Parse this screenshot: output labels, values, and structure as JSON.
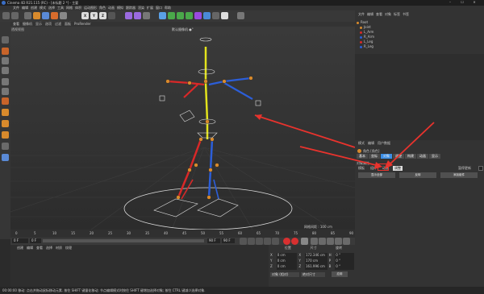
{
  "window": {
    "title": "Cinema 4D R21.115 (RC) - [未标题 2 *] - 主要"
  },
  "menubar": {
    "items": [
      "文件",
      "编辑",
      "创建",
      "模式",
      "选择",
      "工具",
      "网格",
      "体积",
      "运动图形",
      "角色",
      "动画",
      "模拟",
      "跟踪器",
      "渲染",
      "扩展",
      "窗口",
      "帮助"
    ]
  },
  "viewport": {
    "menu": [
      "查看",
      "摄像机",
      "显示",
      "选项",
      "过滤",
      "面板",
      "ProRender"
    ],
    "camera_label": "默认摄像机 ●°",
    "top_left_label": "透视视图",
    "grid_label": "网格间距 : 100 cm"
  },
  "object_manager": {
    "menu": [
      "文件",
      "编辑",
      "查看",
      "对象",
      "标签",
      "书签"
    ],
    "objects": [
      "Root",
      "Joint",
      "L_Arm",
      "R_Arm",
      "L_Leg",
      "R_Leg"
    ]
  },
  "attribute_manager": {
    "menu": [
      "模式",
      "编辑",
      "用户数据"
    ],
    "object_title": "角色 [角色]",
    "tabs": [
      "基本",
      "坐标",
      "对象",
      "调整",
      "构建",
      "动画",
      "显示"
    ],
    "active_tab": "对象",
    "section": "对象属性",
    "subtabs": [
      "模板",
      "组件",
      "动画",
      "调整"
    ],
    "highlight_value": "调整",
    "right_label": "暂停更新",
    "buttons": [
      "显示全部",
      "反转",
      "添加组件"
    ]
  },
  "timeline": {
    "ticks": [
      "0",
      "5",
      "10",
      "15",
      "20",
      "25",
      "30",
      "35",
      "40",
      "45",
      "50",
      "55",
      "60",
      "65",
      "70",
      "75",
      "80",
      "85",
      "90"
    ],
    "start_field": "0 F",
    "end_field": "90 F",
    "current_field": "90 F",
    "frame_label": "0 F"
  },
  "material_manager": {
    "menu": [
      "创建",
      "编辑",
      "查看",
      "选择",
      "材质",
      "纹理"
    ]
  },
  "coordinates": {
    "headers": [
      "位置",
      "尺寸",
      "旋转"
    ],
    "rows": [
      {
        "axis": "X",
        "pos": "0 cm",
        "size_axis": "X",
        "size": "172.346 cm",
        "rot_axis": "H",
        "rot": "0 °"
      },
      {
        "axis": "Y",
        "pos": "0 cm",
        "size_axis": "Y",
        "size": "170 cm",
        "rot_axis": "P",
        "rot": "0 °"
      },
      {
        "axis": "Z",
        "pos": "0 cm",
        "size_axis": "Z",
        "size": "161.996 cm",
        "rot_axis": "B",
        "rot": "0 °"
      }
    ],
    "mode_select": "对象 (相对)",
    "size_select": "绝对尺寸",
    "apply_label": "应用"
  },
  "statusbar": {
    "text": "00:00:00  移动: 点击并拖动鼠标移动元素. 按住 SHIFT 键量化移动; 节点编辑模式时按住 SHIFT 键增加选择对象; 按住 CTRL 键减少选择对象."
  },
  "colors": {
    "accent_blue": "#3a8ee6",
    "annotation_red": "#e8332d",
    "bone_yellow": "#e3e31c"
  }
}
